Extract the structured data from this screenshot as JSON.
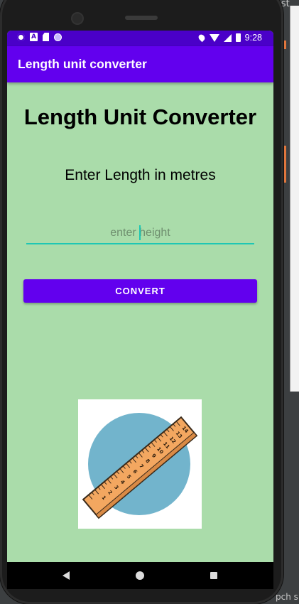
{
  "ide": {
    "top_text": "inst",
    "bottom_text": "pch s"
  },
  "status_bar": {
    "time": "9:28",
    "icons": [
      "gear-icon",
      "a-notification-icon",
      "sd-card-icon",
      "circle-icon",
      "location-icon",
      "wifi-icon",
      "signal-icon",
      "battery-icon"
    ]
  },
  "app_bar": {
    "title": "Length unit converter"
  },
  "main": {
    "heading": "Length Unit Converter",
    "subheading": "Enter Length in metres",
    "input_placeholder": "enter height",
    "input_value": "",
    "convert_label": "CONVERT"
  },
  "ruler_image": {
    "tick_numbers": [
      "1",
      "2",
      "3",
      "4",
      "5",
      "6",
      "7",
      "8",
      "9",
      "10",
      "11",
      "12",
      "13",
      "14"
    ],
    "circle_color": "#72b4cc",
    "ruler_color": "#f3a760"
  },
  "colors": {
    "primary": "#6200ee",
    "status_bar": "#4a00c8",
    "background": "#aadcaa",
    "accent": "#1ec7b4"
  }
}
